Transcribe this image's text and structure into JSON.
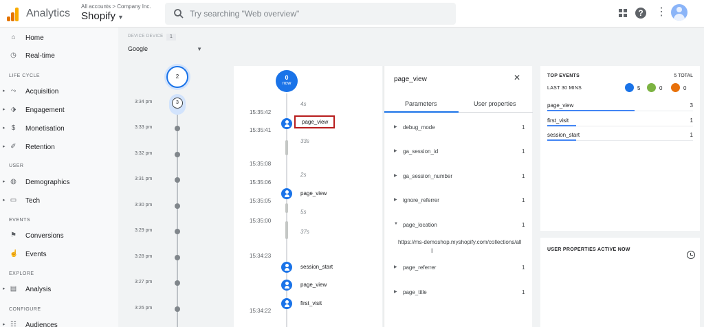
{
  "header": {
    "app_title": "Analytics",
    "breadcrumb": "All accounts > Company Inc.",
    "property": "Shopify",
    "search_placeholder": "Try searching \"Web overview\"",
    "logo_colors": [
      "#f9ab00",
      "#e37400",
      "#e37400"
    ]
  },
  "nav": {
    "home": "Home",
    "realtime": "Real-time",
    "sections": {
      "lifecycle": "LIFE CYCLE",
      "user": "USER",
      "events": "EVENTS",
      "explore": "EXPLORE",
      "configure": "CONFIGURE"
    },
    "acquisition": "Acquisition",
    "engagement": "Engagement",
    "monetisation": "Monetisation",
    "retention": "Retention",
    "demographics": "Demographics",
    "tech": "Tech",
    "conversions": "Conversions",
    "events_item": "Events",
    "analysis": "Analysis",
    "audiences": "Audiences"
  },
  "timeline": {
    "device_label": "DEVICE DEVICE",
    "device_count": "1",
    "device": "Google",
    "top_minute_count": "2",
    "current_minute_count": "3",
    "minutes": [
      "3:34 pm",
      "3:33 pm",
      "3:32 pm",
      "3:31 pm",
      "3:30 pm",
      "3:29 pm",
      "3:28 pm",
      "3:27 pm",
      "3:26 pm"
    ]
  },
  "stream": {
    "now_count": "0",
    "now_label": "now",
    "times": [
      "15:35:42",
      "15:35:41",
      "15:35:08",
      "15:35:06",
      "15:35:05",
      "15:35:00",
      "15:34:23",
      "15:34:22"
    ],
    "gaps": [
      "4s",
      "33s",
      "2s",
      "5s",
      "37s"
    ],
    "events": [
      "page_view",
      "page_view",
      "session_start",
      "page_view",
      "first_visit"
    ]
  },
  "params": {
    "title": "page_view",
    "tab_params": "Parameters",
    "tab_user_props": "User properties",
    "items": [
      {
        "name": "debug_mode",
        "count": "1"
      },
      {
        "name": "ga_session_id",
        "count": "1"
      },
      {
        "name": "ga_session_number",
        "count": "1"
      },
      {
        "name": "ignore_referrer",
        "count": "1"
      },
      {
        "name": "page_location",
        "count": "1"
      },
      {
        "name": "page_referrer",
        "count": "1"
      },
      {
        "name": "page_title",
        "count": "1"
      }
    ],
    "page_location_value": "https://ms-demoshop.myshopify.com/collections/all"
  },
  "top_events": {
    "title": "TOP EVENTS",
    "total": "5 TOTAL",
    "period": "LAST 30 MINS",
    "badges": [
      {
        "count": "5",
        "color": "#1a73e8"
      },
      {
        "count": "0",
        "color": "#7cb342"
      },
      {
        "count": "0",
        "color": "#e8710a"
      }
    ],
    "rows": [
      {
        "name": "page_view",
        "count": "3",
        "share": 0.6
      },
      {
        "name": "first_visit",
        "count": "1",
        "share": 0.2
      },
      {
        "name": "session_start",
        "count": "1",
        "share": 0.2
      }
    ]
  },
  "user_properties": {
    "title": "USER PROPERTIES ACTIVE NOW"
  }
}
